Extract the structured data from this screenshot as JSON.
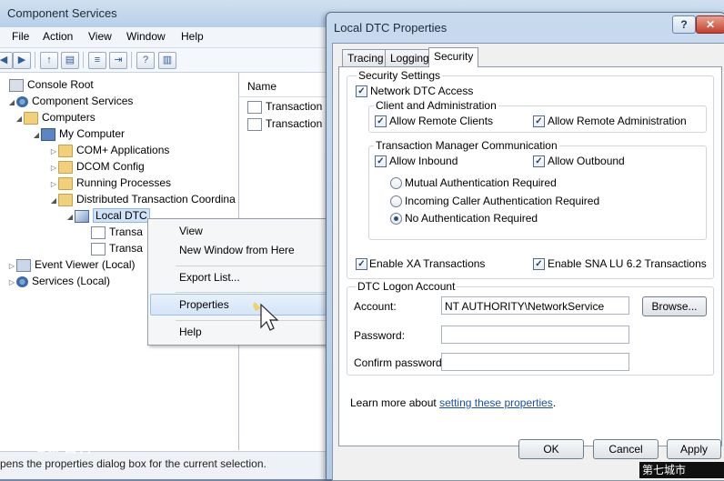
{
  "main_window": {
    "title": "Component Services",
    "menu": [
      "File",
      "Action",
      "View",
      "Window",
      "Help"
    ],
    "tree": [
      {
        "label": "Console Root",
        "level": 0,
        "icon": "console-root-icon",
        "expander": ""
      },
      {
        "label": "Component Services",
        "level": 1,
        "icon": "component-services-icon",
        "expander": "◢"
      },
      {
        "label": "Computers",
        "level": 2,
        "icon": "folder-icon",
        "expander": "◢"
      },
      {
        "label": "My Computer",
        "level": 3,
        "icon": "computer-icon",
        "expander": "◢"
      },
      {
        "label": "COM+ Applications",
        "level": 4,
        "icon": "folder-icon",
        "expander": "▷"
      },
      {
        "label": "DCOM Config",
        "level": 4,
        "icon": "folder-icon",
        "expander": "▷"
      },
      {
        "label": "Running Processes",
        "level": 4,
        "icon": "folder-icon",
        "expander": "▷"
      },
      {
        "label": "Distributed Transaction Coordina",
        "level": 4,
        "icon": "folder-icon",
        "expander": "◢"
      },
      {
        "label": "Local DTC",
        "level": 5,
        "icon": "dtc-icon",
        "expander": "◢",
        "selected": true
      },
      {
        "label": "Transa",
        "level": 6,
        "icon": "document-icon",
        "expander": ""
      },
      {
        "label": "Transa",
        "level": 6,
        "icon": "chart-icon",
        "expander": ""
      },
      {
        "label": "Event Viewer (Local)",
        "level": 0,
        "icon": "event-viewer-icon",
        "expander": "▷"
      },
      {
        "label": "Services (Local)",
        "level": 0,
        "icon": "services-icon",
        "expander": "▷"
      }
    ],
    "list_header": "Name",
    "list_items": [
      "Transaction L",
      "Transaction S"
    ],
    "status_text": "pens the properties dialog box for the current selection."
  },
  "context_menu": {
    "items": [
      "View",
      "New Window from Here",
      "Export List...",
      "Properties",
      "Help"
    ],
    "highlighted": "Properties"
  },
  "dialog": {
    "title": "Local DTC Properties",
    "help_label": "?",
    "close_label": "✕",
    "tabs": [
      "Tracing",
      "Logging",
      "Security"
    ],
    "active_tab": "Security",
    "security_settings": {
      "group_label": "Security Settings",
      "network_dtc_access": {
        "label": "Network DTC Access",
        "checked": true
      },
      "client_admin": {
        "group_label": "Client and Administration",
        "allow_remote_clients": {
          "label": "Allow Remote Clients",
          "checked": true
        },
        "allow_remote_admin": {
          "label": "Allow Remote Administration",
          "checked": true
        }
      },
      "tm_comm": {
        "group_label": "Transaction Manager Communication",
        "allow_inbound": {
          "label": "Allow Inbound",
          "checked": true
        },
        "allow_outbound": {
          "label": "Allow Outbound",
          "checked": true
        },
        "radios": [
          {
            "label": "Mutual Authentication Required",
            "selected": false
          },
          {
            "label": "Incoming Caller Authentication Required",
            "selected": false
          },
          {
            "label": "No Authentication Required",
            "selected": true
          }
        ]
      },
      "enable_xa": {
        "label": "Enable XA Transactions",
        "checked": true
      },
      "enable_sna": {
        "label": "Enable SNA LU 6.2 Transactions",
        "checked": true
      }
    },
    "logon": {
      "group_label": "DTC Logon Account",
      "account_label": "Account:",
      "account_value": "NT AUTHORITY\\NetworkService",
      "browse_label": "Browse...",
      "password_label": "Password:",
      "password_value": "",
      "confirm_label": "Confirm password:",
      "confirm_value": ""
    },
    "learn_more_prefix": "Learn more about ",
    "learn_more_link": "setting these properties",
    "learn_more_suffix": ".",
    "buttons": {
      "ok": "OK",
      "cancel": "Cancel",
      "apply": "Apply"
    }
  },
  "watermark_text": "Bai 百科",
  "corner_text": "第七城市"
}
